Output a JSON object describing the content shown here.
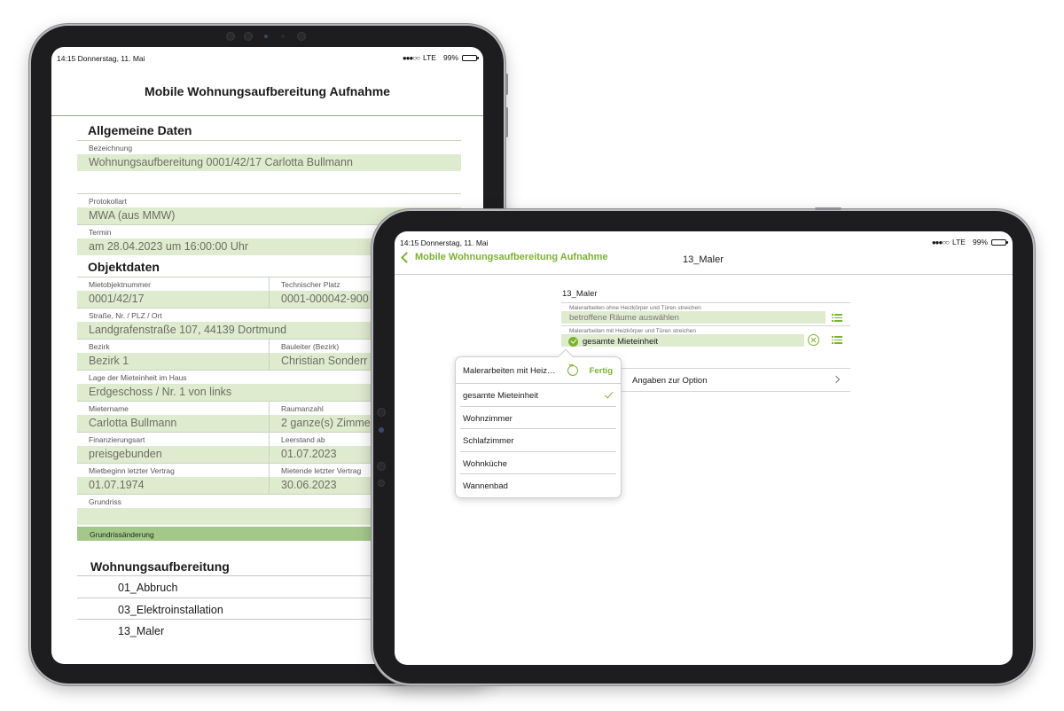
{
  "left_device": {
    "status_bar": {
      "time": "14:15 Donnerstag, 11. Mai",
      "signal": "●●●○○",
      "network": "LTE",
      "battery": "99%",
      "battery_level": 0.99
    },
    "title": "Mobile Wohnungsaufbereitung Aufnahme",
    "general": {
      "heading": "Allgemeine Daten",
      "bezeichnung": {
        "label": "Bezeichnung",
        "value": "Wohnungsaufbereitung 0001/42/17 Carlotta Bullmann"
      },
      "protokollart": {
        "label": "Protokollart",
        "value": "MWA (aus MMW)"
      },
      "termin": {
        "label": "Termin",
        "value": "am 28.04.2023 um 16:00:00 Uhr"
      }
    },
    "object": {
      "heading": "Objektdaten",
      "mietobjektnummer": {
        "label": "Mietobjektnummer",
        "value": "0001/42/17"
      },
      "technischer_platz": {
        "label": "Technischer Platz",
        "value": "0001-000042-900"
      },
      "adresse": {
        "label": "Straße, Nr. / PLZ / Ort",
        "value": "Landgrafenstraße 107, 44139 Dortmund"
      },
      "bezirk": {
        "label": "Bezirk",
        "value": "Bezirk 1"
      },
      "bauleiter": {
        "label": "Bauleiter (Bezirk)",
        "value": "Christian Sonderr"
      },
      "lage": {
        "label": "Lage der Mieteinheit im Haus",
        "value": "Erdgeschoss / Nr. 1 von links"
      },
      "mietername": {
        "label": "Mietername",
        "value": "Carlotta Bullmann"
      },
      "raumanzahl": {
        "label": "Raumanzahl",
        "value": "2 ganze(s) Zimme"
      },
      "finanzierungsart": {
        "label": "Finanzierungsart",
        "value": "preisgebunden"
      },
      "leerstand": {
        "label": "Leerstand ab",
        "value": "01.07.2023"
      },
      "mietbeginn": {
        "label": "Mietbeginn letzter Vertrag",
        "value": "01.07.1974"
      },
      "mietende": {
        "label": "Mietende letzter Vertrag",
        "value": "30.06.2023"
      },
      "grundriss": {
        "label": "Grundriss",
        "value": ""
      }
    },
    "banner": "Grundrissänderung",
    "refurbishment": {
      "heading": "Wohnungsaufbereitung",
      "items": [
        "01_Abbruch",
        "03_Elektroinstallation",
        "13_Maler"
      ]
    }
  },
  "right_device": {
    "status_bar": {
      "time": "14:15 Donnerstag, 11. Mai",
      "signal": "●●●○○",
      "network": "LTE",
      "battery": "99%",
      "battery_level": 0.99
    },
    "nav": {
      "back_label": "Mobile Wohnungsaufbereitung Aufnahme",
      "title": "13_Maler"
    },
    "section_title": "13_Maler",
    "fields": [
      {
        "label": "Malerarbeiten ohne Heizkörper und Türen streichen",
        "value": "betroffene Räume auswählen"
      },
      {
        "label": "Malerarbeiten mit Heizkörper und Türen streichen",
        "value": "gesamte Mieteinheit"
      }
    ],
    "option_row": {
      "label": "Angaben zur Option"
    },
    "popover": {
      "title": "Malerarbeiten mit Heizkörper und Türen streichen",
      "done_label": "Fertig",
      "items": [
        {
          "label": "gesamte Mieteinheit",
          "selected": true
        },
        {
          "label": "Wohnzimmer",
          "selected": false
        },
        {
          "label": "Schlafzimmer",
          "selected": false
        },
        {
          "label": "Wohnküche",
          "selected": false
        },
        {
          "label": "Wannenbad",
          "selected": false
        }
      ]
    }
  },
  "colors": {
    "accent": "#7ab32e",
    "field_background": "#dfebcf",
    "banner_background": "#a3c98a",
    "device_frame": "#1d1d1f"
  }
}
